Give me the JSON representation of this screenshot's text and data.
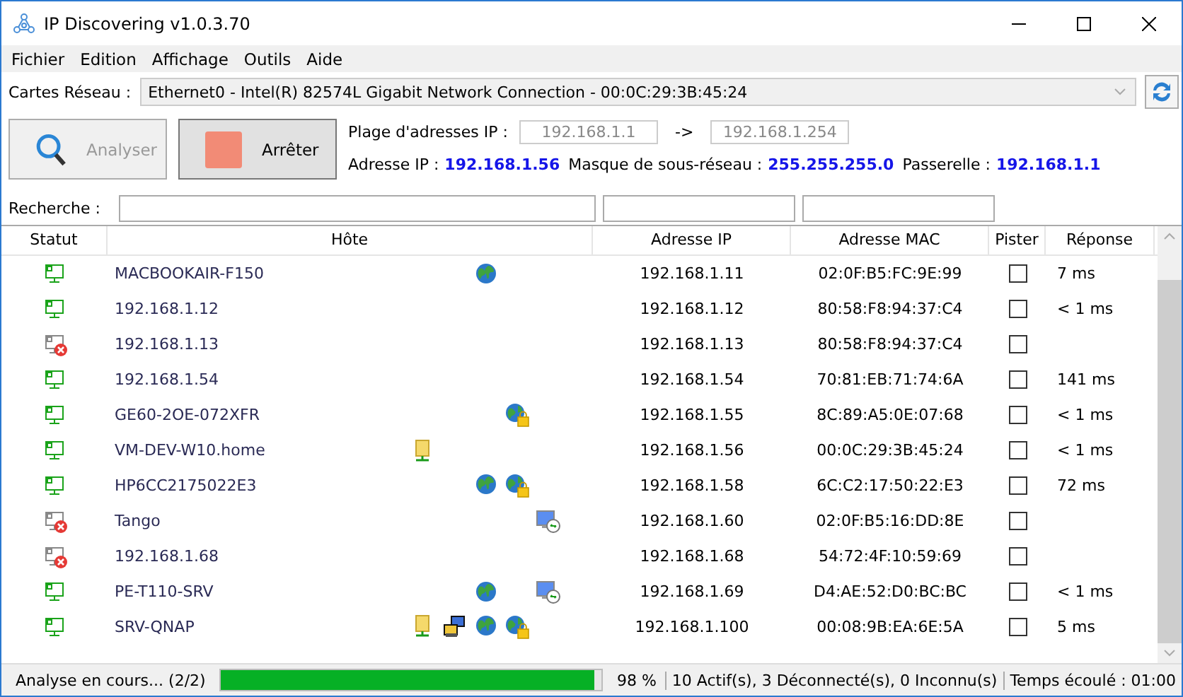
{
  "window": {
    "title": "IP Discovering v1.0.3.70"
  },
  "menu": [
    "Fichier",
    "Edition",
    "Affichage",
    "Outils",
    "Aide"
  ],
  "network_card": {
    "label": "Cartes Réseau :",
    "value": "Ethernet0 - Intel(R) 82574L Gigabit Network Connection - 00:0C:29:3B:45:24"
  },
  "buttons": [
    {
      "label": "Analyser",
      "kind": "scan",
      "disabled": true
    },
    {
      "label": "Arrêter",
      "kind": "stop",
      "disabled": false
    }
  ],
  "range": {
    "label": "Plage d'adresses IP :",
    "start": "192.168.1.1",
    "arrow": "->",
    "end": "192.168.1.254"
  },
  "info": [
    {
      "label": "Adresse IP :",
      "value": "192.168.1.56"
    },
    {
      "label": "Masque de sous-réseau :",
      "value": "255.255.255.0"
    },
    {
      "label": "Passerelle :",
      "value": "192.168.1.1"
    }
  ],
  "search": {
    "label": "Recherche :"
  },
  "table": {
    "columns": [
      "Statut",
      "Hôte",
      "Adresse IP",
      "Adresse MAC",
      "Pister",
      "Réponse"
    ],
    "rows": [
      {
        "online": true,
        "host": "MACBOOKAIR-F150",
        "services": [
          {
            "kind": "web"
          }
        ],
        "ip": "192.168.1.11",
        "mac": "02:0F:B5:FC:9E:99",
        "tracked": false,
        "response": "7 ms"
      },
      {
        "online": true,
        "host": "192.168.1.12",
        "services": [],
        "ip": "192.168.1.12",
        "mac": "80:58:F8:94:37:C4",
        "tracked": false,
        "response": "< 1 ms"
      },
      {
        "online": false,
        "host": "192.168.1.13",
        "services": [],
        "ip": "192.168.1.13",
        "mac": "80:58:F8:94:37:C4",
        "tracked": false
      },
      {
        "online": true,
        "host": "192.168.1.54",
        "services": [],
        "ip": "192.168.1.54",
        "mac": "70:81:EB:71:74:6A",
        "tracked": false,
        "response": "141 ms"
      },
      {
        "online": true,
        "host": "GE60-2OE-072XFR",
        "services": [
          {
            "kind": "secure-web"
          }
        ],
        "ip": "192.168.1.55",
        "mac": "8C:89:A5:0E:07:68",
        "tracked": false,
        "response": "< 1 ms"
      },
      {
        "online": true,
        "host": "VM-DEV-W10.home",
        "services": [
          {
            "kind": "share"
          }
        ],
        "ip": "192.168.1.56",
        "mac": "00:0C:29:3B:45:24",
        "tracked": false,
        "response": "< 1 ms"
      },
      {
        "online": true,
        "host": "HP6CC2175022E3",
        "services": [
          {
            "kind": "web"
          },
          {
            "kind": "secure-web"
          }
        ],
        "ip": "192.168.1.58",
        "mac": "6C:C2:17:50:22:E3",
        "tracked": false,
        "response": "72 ms"
      },
      {
        "online": false,
        "host": "Tango",
        "services": [
          {
            "kind": "remote"
          }
        ],
        "ip": "192.168.1.60",
        "mac": "02:0F:B5:16:DD:8E",
        "tracked": false
      },
      {
        "online": false,
        "host": "192.168.1.68",
        "services": [],
        "ip": "192.168.1.68",
        "mac": "54:72:4F:10:59:69",
        "tracked": false
      },
      {
        "online": true,
        "host": "PE-T110-SRV",
        "services": [
          {
            "kind": "web"
          },
          {
            "kind": "remote"
          }
        ],
        "ip": "192.168.1.69",
        "mac": "D4:AE:52:D0:BC:BC",
        "tracked": false,
        "response": "< 1 ms"
      },
      {
        "online": true,
        "host": "SRV-QNAP",
        "services": [
          {
            "kind": "share"
          },
          {
            "kind": "network"
          },
          {
            "kind": "web"
          },
          {
            "kind": "secure-web"
          }
        ],
        "ip": "192.168.1.100",
        "mac": "00:08:9B:EA:6E:5A",
        "tracked": false,
        "response": "5 ms"
      }
    ]
  },
  "status_bar": {
    "message": "Analyse en cours... (2/2)",
    "level": 0.98,
    "percent": "98 %",
    "counts": "10 Actif(s), 3 Déconnecté(s), 0 Inconnu(s)",
    "elapsed": "Temps écoulé : 01:00"
  }
}
